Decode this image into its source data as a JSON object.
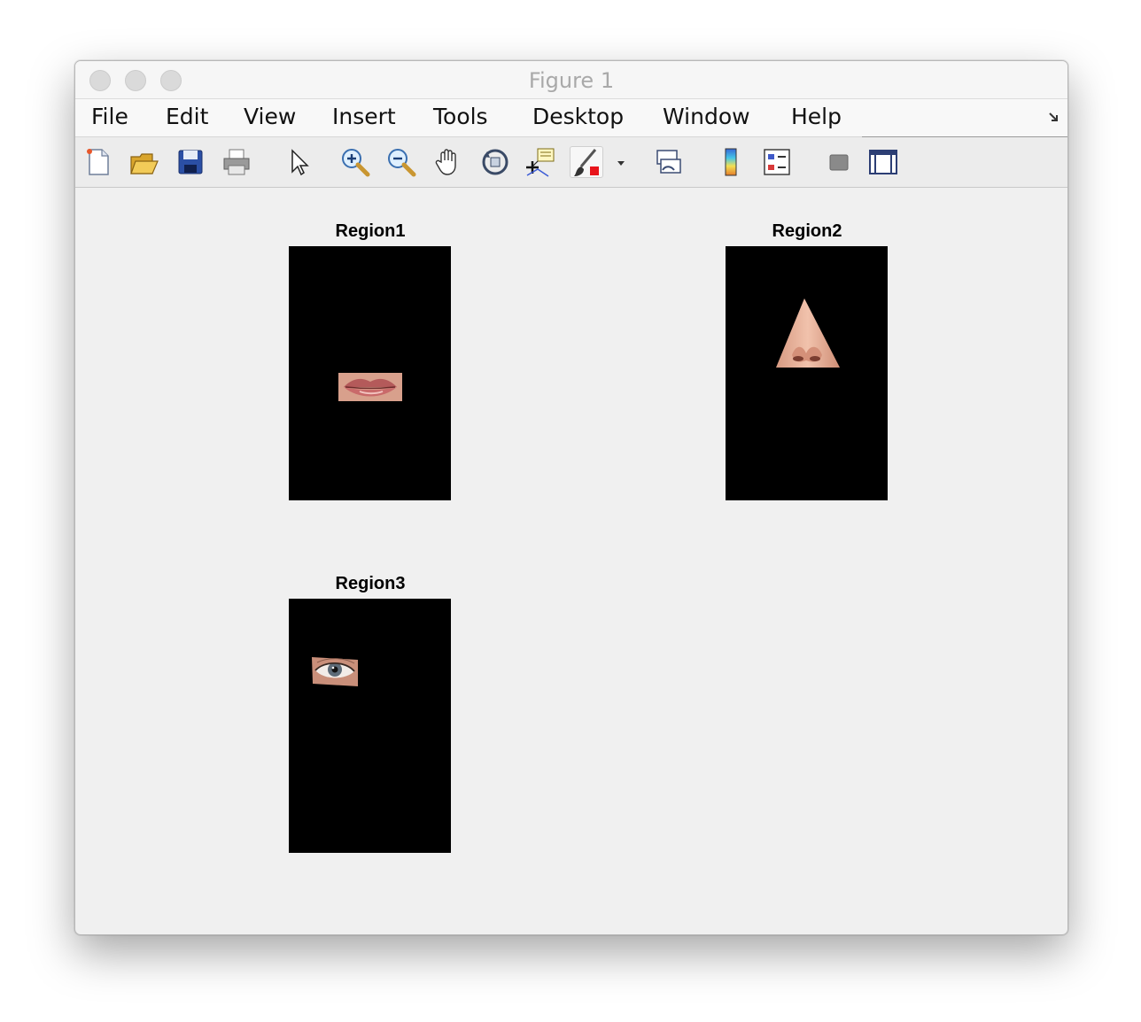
{
  "window": {
    "title": "Figure 1"
  },
  "menu": [
    "File",
    "Edit",
    "View",
    "Insert",
    "Tools",
    "Desktop",
    "Window",
    "Help"
  ],
  "toolbar": {
    "buttons": [
      "new-figure-icon",
      "open-file-icon",
      "save-icon",
      "print-icon",
      "pointer-icon",
      "zoom-in-icon",
      "zoom-out-icon",
      "pan-hand-icon",
      "rotate-3d-icon",
      "data-cursor-icon",
      "brush-icon",
      "dropdown-arrow-icon",
      "link-plot-icon",
      "colorbar-icon",
      "legend-icon",
      "hide-plot-tools-icon",
      "show-plot-tools-icon"
    ]
  },
  "subplots": [
    {
      "title": "Region1",
      "content": "lips"
    },
    {
      "title": "Region2",
      "content": "nose"
    },
    {
      "title": "Region3",
      "content": "eye"
    }
  ]
}
